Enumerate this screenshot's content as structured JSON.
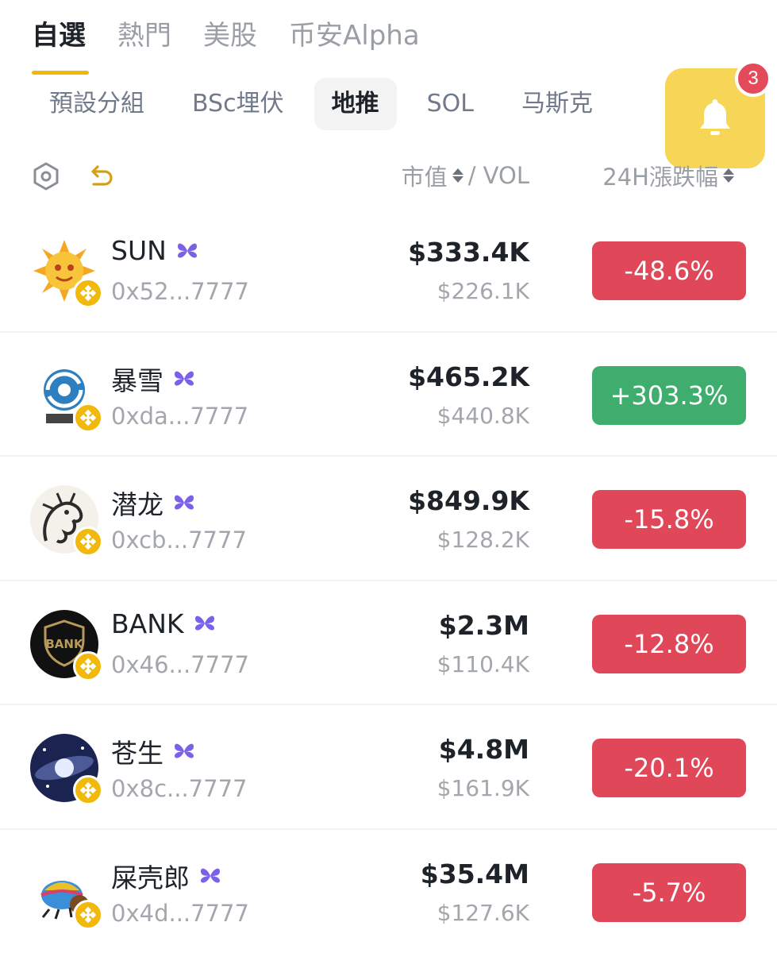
{
  "top_tabs": [
    "自選",
    "熱門",
    "美股",
    "币安Alpha"
  ],
  "sub_tabs": [
    "預設分組",
    "BSc埋伏",
    "地推",
    "SOL",
    "马斯克"
  ],
  "active_sub_tab": "地推",
  "notification_count": "3",
  "header": {
    "mcap_label": "市值",
    "vol_label": "/ VOL",
    "change_label": "24H漲跌幅"
  },
  "colors": {
    "accent": "#f0b90b",
    "down": "#e0485a",
    "up": "#3fad6d",
    "bell_bg": "#f6d557"
  },
  "tokens": [
    {
      "name": "SUN",
      "address": "0x52...7777",
      "mcap": "$333.4K",
      "vol": "$226.1K",
      "change": "-48.6%",
      "direction": "down",
      "avatar": "sun-face-icon"
    },
    {
      "name": "暴雪",
      "address": "0xda...7777",
      "mcap": "$465.2K",
      "vol": "$440.8K",
      "change": "+303.3%",
      "direction": "up",
      "avatar": "blizzard-swirl-icon"
    },
    {
      "name": "潜龙",
      "address": "0xcb...7777",
      "mcap": "$849.9K",
      "vol": "$128.2K",
      "change": "-15.8%",
      "direction": "down",
      "avatar": "dragon-icon"
    },
    {
      "name": "BANK",
      "address": "0x46...7777",
      "mcap": "$2.3M",
      "vol": "$110.4K",
      "change": "-12.8%",
      "direction": "down",
      "avatar": "bank-shield-icon"
    },
    {
      "name": "苍生",
      "address": "0x8c...7777",
      "mcap": "$4.8M",
      "vol": "$161.9K",
      "change": "-20.1%",
      "direction": "down",
      "avatar": "galaxy-icon"
    },
    {
      "name": "屎壳郎",
      "address": "0x4d...7777",
      "mcap": "$35.4M",
      "vol": "$127.6K",
      "change": "-5.7%",
      "direction": "down",
      "avatar": "dung-beetle-icon"
    }
  ]
}
